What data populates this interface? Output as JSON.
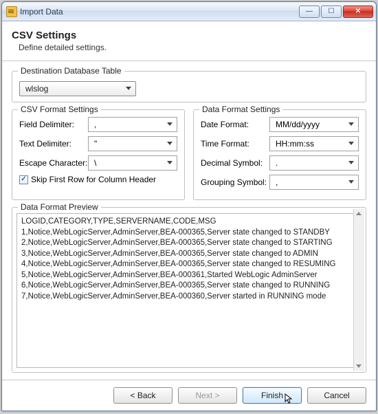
{
  "window": {
    "title": "Import Data"
  },
  "header": {
    "title": "CSV Settings",
    "subtitle": "Define detailed settings."
  },
  "destination": {
    "label": "Destination Database Table",
    "value": "wlslog"
  },
  "csv_group": {
    "title": "CSV Format Settings",
    "field_delimiter_label": "Field Delimiter:",
    "field_delimiter_value": ",",
    "text_delimiter_label": "Text Delimiter:",
    "text_delimiter_value": "\"",
    "escape_char_label": "Escape Character:",
    "escape_char_value": "\\",
    "skip_first_row_checked": true,
    "skip_first_row_label": "Skip First Row for Column Header"
  },
  "data_group": {
    "title": "Data Format Settings",
    "date_format_label": "Date Format:",
    "date_format_value": "MM/dd/yyyy",
    "time_format_label": "Time Format:",
    "time_format_value": "HH:mm:ss",
    "decimal_symbol_label": "Decimal Symbol:",
    "decimal_symbol_value": ".",
    "grouping_symbol_label": "Grouping Symbol:",
    "grouping_symbol_value": ","
  },
  "preview": {
    "title": "Data Format Preview",
    "lines": [
      "LOGID,CATEGORY,TYPE,SERVERNAME,CODE,MSG",
      "1,Notice,WebLogicServer,AdminServer,BEA-000365,Server state changed to STANDBY",
      "2,Notice,WebLogicServer,AdminServer,BEA-000365,Server state changed to STARTING",
      "3,Notice,WebLogicServer,AdminServer,BEA-000365,Server state changed to ADMIN",
      "4,Notice,WebLogicServer,AdminServer,BEA-000365,Server state changed to RESUMING",
      "5,Notice,WebLogicServer,AdminServer,BEA-000361,Started WebLogic AdminServer",
      "6,Notice,WebLogicServer,AdminServer,BEA-000365,Server state changed to RUNNING",
      "7,Notice,WebLogicServer,AdminServer,BEA-000360,Server started in RUNNING mode"
    ]
  },
  "buttons": {
    "back": "< Back",
    "next": "Next >",
    "finish": "Finish",
    "cancel": "Cancel"
  }
}
